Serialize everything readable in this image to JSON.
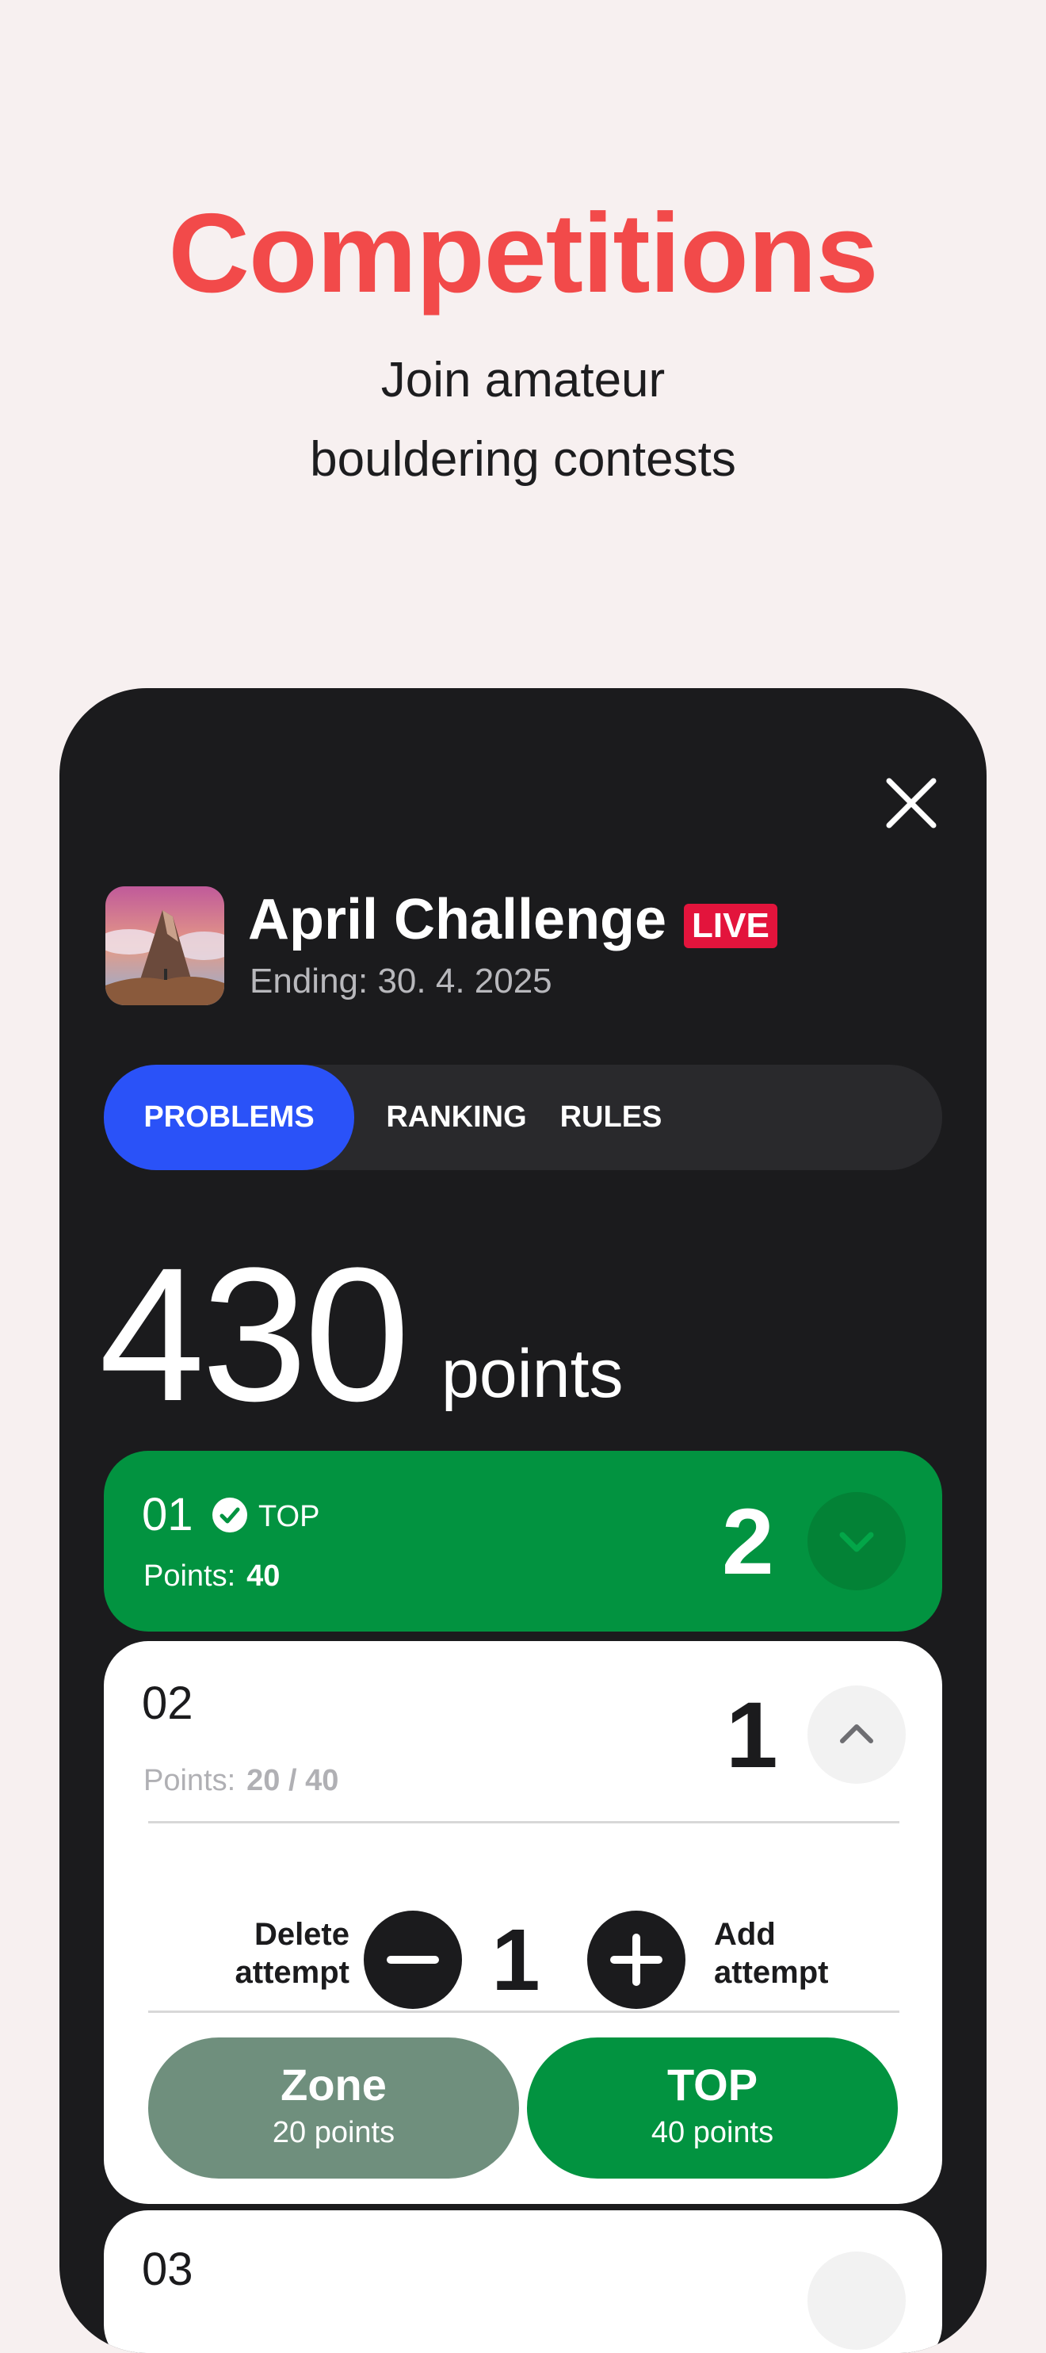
{
  "hero": {
    "title": "Competitions",
    "subtitle_line1": "Join amateur",
    "subtitle_line2": "bouldering contests"
  },
  "competition": {
    "name": "April Challenge",
    "live_badge": "LIVE",
    "ending": "Ending: 30. 4. 2025"
  },
  "tabs": [
    {
      "label": "PROBLEMS",
      "active": true
    },
    {
      "label": "RANKING",
      "active": false
    },
    {
      "label": "RULES",
      "active": false
    }
  ],
  "score": {
    "value": "430",
    "unit": "points"
  },
  "problems": [
    {
      "number": "01",
      "status": "TOP",
      "points_label": "Points:",
      "points_value": "40",
      "attempts": "2",
      "expanded": false
    },
    {
      "number": "02",
      "points_label": "Points:",
      "points_value": "20 / 40",
      "attempts": "1",
      "expanded": true,
      "delete_label_1": "Delete",
      "delete_label_2": "attempt",
      "add_label_1": "Add",
      "add_label_2": "attempt",
      "attempt_count": "1",
      "zone": {
        "label": "Zone",
        "points": "20 points"
      },
      "top": {
        "label": "TOP",
        "points": "40 points"
      }
    },
    {
      "number": "03"
    }
  ],
  "colors": {
    "accent_red": "#f24a4a",
    "live_red": "#e3143c",
    "tab_blue": "#2a52f8",
    "top_green": "#029340",
    "zone_gray_green": "#6f8f7d",
    "dark": "#1b1b1d"
  },
  "icons": [
    "close-icon",
    "check-circle-icon",
    "chevron-down-icon",
    "chevron-up-icon",
    "minus-icon",
    "plus-icon",
    "mountain-app-icon"
  ]
}
